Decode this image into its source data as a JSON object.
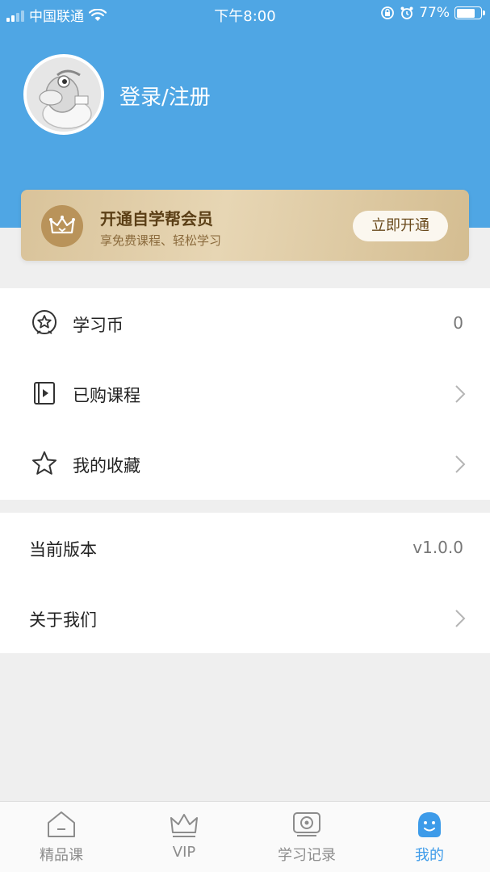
{
  "status_bar": {
    "carrier": "中国联通",
    "time": "下午8:00",
    "battery": "77%"
  },
  "profile": {
    "login_label": "登录/注册"
  },
  "vip": {
    "title": "开通自学帮会员",
    "subtitle": "享免费课程、轻松学习",
    "button": "立即开通",
    "icon": "crown-icon"
  },
  "menu": [
    {
      "label": "学习币",
      "value": "0",
      "icon": "coin-star-icon"
    },
    {
      "label": "已购课程",
      "icon": "video-book-icon"
    },
    {
      "label": "我的收藏",
      "icon": "star-icon"
    }
  ],
  "info": [
    {
      "label": "当前版本",
      "value": "v1.0.0"
    },
    {
      "label": "关于我们"
    }
  ],
  "tabs": [
    {
      "label": "精品课",
      "icon": "home-icon",
      "active": false
    },
    {
      "label": "VIP",
      "icon": "crown-icon",
      "active": false
    },
    {
      "label": "学习记录",
      "icon": "record-icon",
      "active": false
    },
    {
      "label": "我的",
      "icon": "smile-icon",
      "active": true
    }
  ],
  "colors": {
    "header": "#4fa6e4",
    "active_tab": "#3d9be9",
    "vip_gold": "#d9c39a"
  }
}
